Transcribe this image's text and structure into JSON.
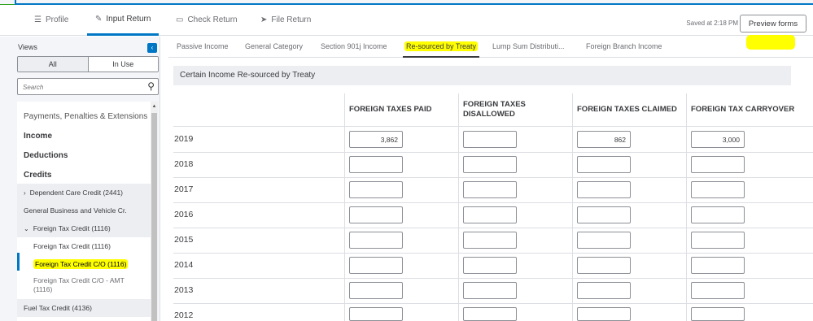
{
  "top_nav": {
    "tabs": [
      {
        "label": "Profile",
        "icon": "list-icon",
        "active": false
      },
      {
        "label": "Input Return",
        "icon": "pencil-icon",
        "active": true
      },
      {
        "label": "Check Return",
        "icon": "document-icon",
        "active": false
      },
      {
        "label": "File Return",
        "icon": "send-icon",
        "active": false
      }
    ],
    "saved_text": "Saved at 2:18 PM",
    "preview_label": "Preview forms"
  },
  "sidebar": {
    "title": "Views",
    "toggle": {
      "all": "All",
      "in_use": "In Use"
    },
    "search_placeholder": "Search",
    "items": [
      {
        "label": "Payments, Penalties & Extensions"
      },
      {
        "label": "Income"
      },
      {
        "label": "Deductions"
      },
      {
        "label": "Credits"
      },
      {
        "label": "Dependent Care Credit (2441)"
      },
      {
        "label": "General Business and Vehicle Cr."
      },
      {
        "label": "Foreign Tax Credit (1116)"
      },
      {
        "label": "Foreign Tax Credit (1116)"
      },
      {
        "label": "Foreign Tax Credit C/O (1116)"
      },
      {
        "label": "Foreign Tax Credit C/O - AMT (1116)"
      },
      {
        "label": "Fuel Tax Credit (4136)"
      }
    ]
  },
  "sub_tabs": [
    {
      "label": "Passive Income",
      "active": false
    },
    {
      "label": "General Category",
      "active": false
    },
    {
      "label": "Section 901j Income",
      "active": false
    },
    {
      "label": "Re-sourced by Treaty",
      "active": true
    },
    {
      "label": "Lump Sum Distributi...",
      "active": false
    },
    {
      "label": "Foreign Branch Income",
      "active": false
    }
  ],
  "section_title": "Certain Income Re-sourced by Treaty",
  "table": {
    "columns": [
      "FOREIGN TAXES PAID",
      "FOREIGN TAXES DISALLOWED",
      "FOREIGN TAXES CLAIMED",
      "FOREIGN TAX CARRYOVER"
    ],
    "rows": [
      {
        "year": "2019",
        "values": [
          "3,862",
          "",
          "862",
          "3,000"
        ]
      },
      {
        "year": "2018",
        "values": [
          "",
          "",
          "",
          ""
        ]
      },
      {
        "year": "2017",
        "values": [
          "",
          "",
          "",
          ""
        ]
      },
      {
        "year": "2016",
        "values": [
          "",
          "",
          "",
          ""
        ]
      },
      {
        "year": "2015",
        "values": [
          "",
          "",
          "",
          ""
        ]
      },
      {
        "year": "2014",
        "values": [
          "",
          "",
          "",
          ""
        ]
      },
      {
        "year": "2013",
        "values": [
          "",
          "",
          "",
          ""
        ]
      },
      {
        "year": "2012",
        "values": [
          "",
          "",
          "",
          ""
        ]
      }
    ]
  },
  "colors": {
    "accent": "#0077c5",
    "highlight": "#ffff00"
  }
}
